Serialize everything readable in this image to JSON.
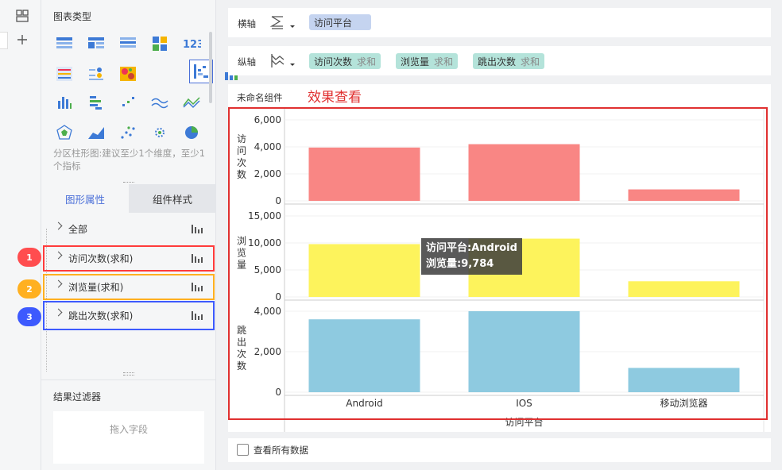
{
  "left_panel": {
    "chart_type_title": "图表类型",
    "hint": "分区柱形图:建议至少1个维度，至少1个指标",
    "tabs": [
      "图形属性",
      "组件样式"
    ],
    "props": [
      {
        "label": "全部"
      },
      {
        "label": "访问次数(求和)",
        "badge": "1",
        "badge_color": "#ff4d4f",
        "box_color": "#ff3b3b"
      },
      {
        "label": "浏览量(求和)",
        "badge": "2",
        "badge_color": "#ffb020",
        "box_color": "#ffb020"
      },
      {
        "label": "跳出次数(求和)",
        "badge": "3",
        "badge_color": "#3d5afe",
        "box_color": "#3d5afe"
      }
    ],
    "filter_title": "结果过滤器",
    "filter_drop": "拖入字段"
  },
  "axes": {
    "x_label": "横轴",
    "x_fields": [
      {
        "name": "访问平台"
      }
    ],
    "y_label": "纵轴",
    "y_fields": [
      {
        "name": "访问次数",
        "agg": "求和"
      },
      {
        "name": "浏览量",
        "agg": "求和"
      },
      {
        "name": "跳出次数",
        "agg": "求和"
      }
    ]
  },
  "component": {
    "name": "未命名组件",
    "annotation": "效果查看",
    "annotation_color": "#e03030"
  },
  "tooltip": {
    "line1": "访问平台:Android",
    "line2": "浏览量:9,784"
  },
  "footer": {
    "show_all": "查看所有数据"
  },
  "chart_data": {
    "type": "bar",
    "categories": [
      "Android",
      "IOS",
      "移动浏览器"
    ],
    "xlabel": "访问平台",
    "panels": [
      {
        "ylabel": "访问次数",
        "yticks": [
          "6,000",
          "4,000",
          "2,000",
          "0"
        ],
        "ylim": [
          0,
          6000
        ],
        "color": "#f98684",
        "values": [
          3950,
          4200,
          850
        ]
      },
      {
        "ylabel": "浏览量",
        "yticks": [
          "15,000",
          "10,000",
          "5,000",
          "0"
        ],
        "ylim": [
          0,
          15000
        ],
        "color": "#fdf35c",
        "values": [
          9784,
          10800,
          2900
        ]
      },
      {
        "ylabel": "跳出次数",
        "yticks": [
          "4,000",
          "2,000",
          "0"
        ],
        "ylim": [
          0,
          4000
        ],
        "color": "#8ecae0",
        "values": [
          3600,
          4000,
          1200
        ]
      }
    ]
  }
}
